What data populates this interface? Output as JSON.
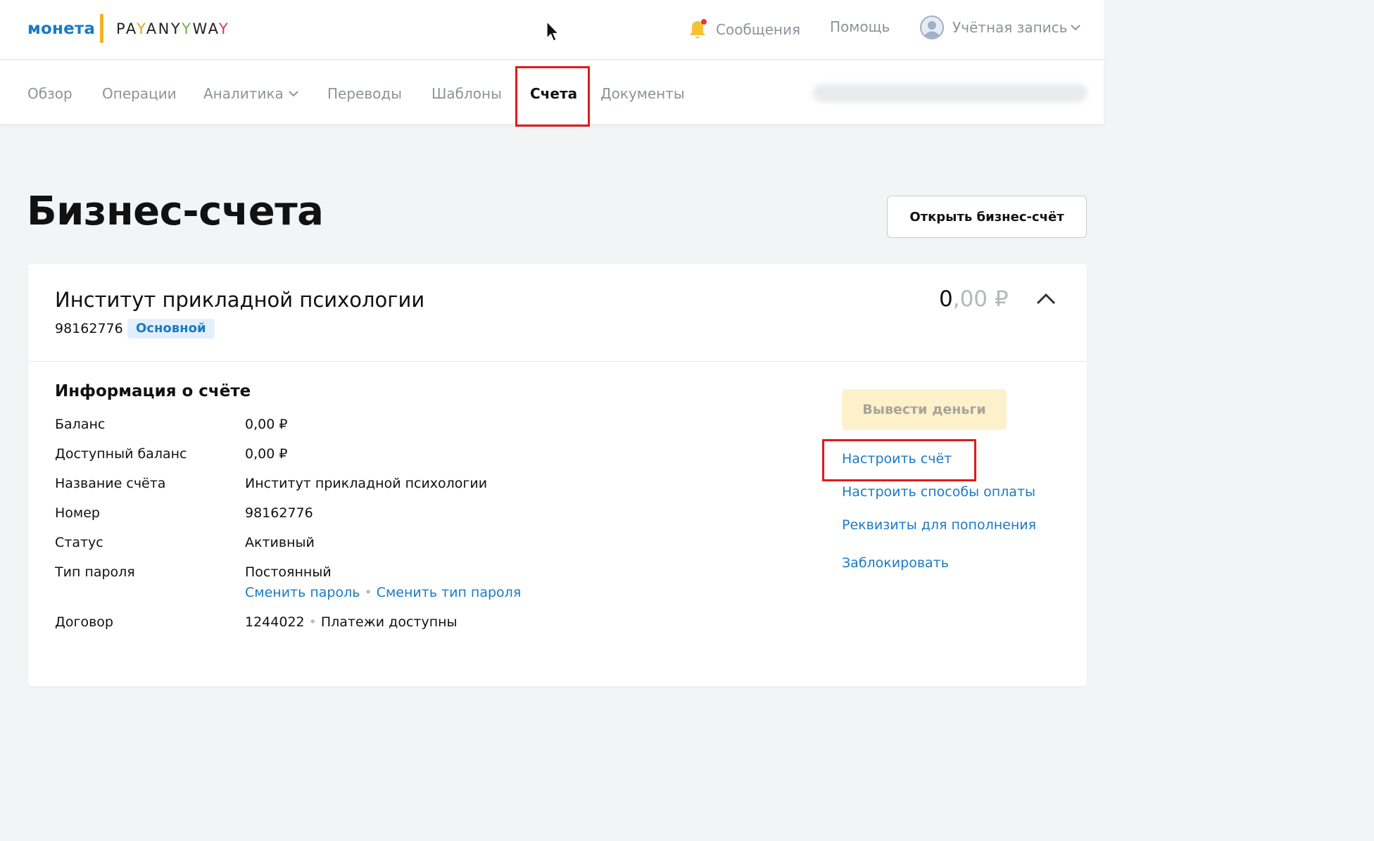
{
  "header": {
    "logo_left": "монета",
    "logo_right_parts": [
      "PA",
      "Y",
      "ANY",
      "WA",
      "Y"
    ],
    "messages_label": "Сообщения",
    "help_label": "Помощь",
    "account_label": "Учётная запись",
    "icons": {
      "messages": "bell-icon",
      "account": "user-avatar-icon",
      "dropdown": "chevron-down-icon"
    },
    "colors": {
      "brand_blue": "#1a7ac6",
      "brand_yellow": "#f4b21f",
      "notification_dot": "#e53935"
    }
  },
  "nav": {
    "items": [
      {
        "label": "Обзор"
      },
      {
        "label": "Операции"
      },
      {
        "label": "Аналитика"
      },
      {
        "label": "Переводы"
      },
      {
        "label": "Шаблоны"
      },
      {
        "label": "Счета"
      },
      {
        "label": "Документы"
      }
    ],
    "active_index": 5
  },
  "page": {
    "title": "Бизнес-счета",
    "open_button": "Открыть бизнес-счёт"
  },
  "account": {
    "name": "Институт прикладной психологии",
    "number": "98162776",
    "badge": "Основной",
    "balance_int": "0",
    "balance_dec": ",00 ₽",
    "info_title": "Информация о счёте",
    "rows": [
      {
        "label": "Баланс",
        "value": "0,00 ₽"
      },
      {
        "label": "Доступный баланс",
        "value": "0,00 ₽"
      },
      {
        "label": "Название счёта",
        "value": "Институт прикладной психологии"
      },
      {
        "label": "Номер",
        "value": "98162776"
      },
      {
        "label": "Статус",
        "value": "Активный"
      },
      {
        "label": "Тип пароля",
        "value": "Постоянный"
      }
    ],
    "password_links": [
      "Сменить пароль",
      "Сменить тип пароля"
    ],
    "contract_label": "Договор",
    "contract_number": "1244022",
    "contract_status": "Платежи доступны",
    "withdraw_button": "Вывести деньги",
    "actions": [
      "Настроить счёт",
      "Настроить способы оплаты",
      "Реквизиты для пополнения",
      "Заблокировать"
    ]
  },
  "highlight_color": "#e01b1b"
}
